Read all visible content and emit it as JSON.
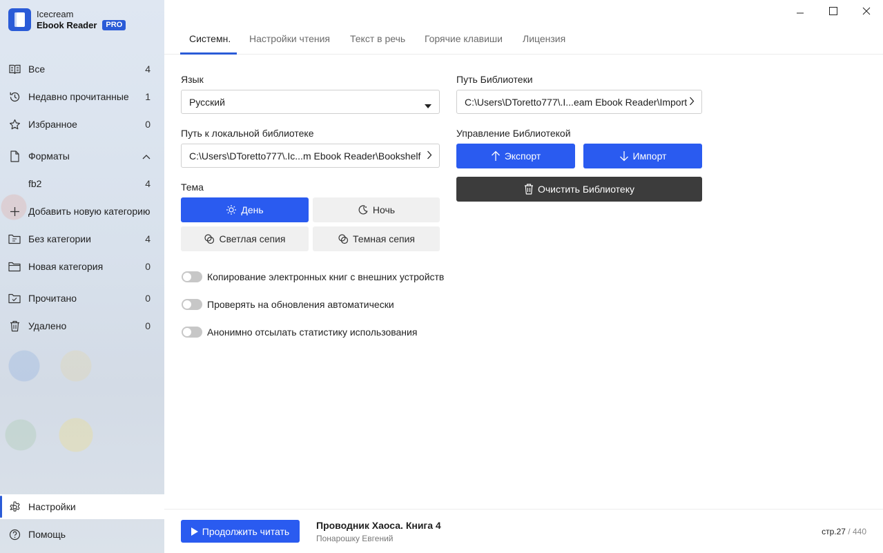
{
  "app": {
    "name_line1": "Icecream",
    "name_line2": "Ebook Reader",
    "badge": "PRO"
  },
  "sidebar": {
    "items": [
      {
        "label": "Все",
        "count": "4",
        "icon": "book-open-icon"
      },
      {
        "label": "Недавно прочитанные",
        "count": "1",
        "icon": "history-icon"
      },
      {
        "label": "Избранное",
        "count": "0",
        "icon": "star-icon"
      },
      {
        "label": "Форматы",
        "icon": "file-icon"
      },
      {
        "label": "fb2",
        "count": "4"
      },
      {
        "label": "Добавить новую категорию",
        "icon": "plus-icon"
      },
      {
        "label": "Без категории",
        "count": "4",
        "icon": "folder-books-icon"
      },
      {
        "label": "Новая категория",
        "count": "0",
        "icon": "folder-icon"
      },
      {
        "label": "Прочитано",
        "count": "0",
        "icon": "folder-check-icon"
      },
      {
        "label": "Удалено",
        "count": "0",
        "icon": "trash-icon"
      }
    ],
    "settings_label": "Настройки",
    "help_label": "Помощь"
  },
  "tabs": [
    "Системн.",
    "Настройки чтения",
    "Текст в речь",
    "Горячие клавиши",
    "Лицензия"
  ],
  "settings": {
    "language_label": "Язык",
    "language_value": "Русский",
    "local_path_label": "Путь к локальной библиотеке",
    "local_path_value": "C:\\Users\\DToretto777\\.Ic...m Ebook Reader\\Bookshelf",
    "theme_label": "Тема",
    "themes": [
      "День",
      "Ночь",
      "Светлая сепия",
      "Темная сепия"
    ],
    "selected_theme": "День",
    "library_path_label": "Путь Библиотеки",
    "library_path_value": "C:\\Users\\DToretto777\\.I...eam Ebook Reader\\Import",
    "library_manage_label": "Управление Библиотекой",
    "export_label": "Экспорт",
    "import_label": "Импорт",
    "clear_label": "Очистить Библиотеку",
    "toggles": [
      {
        "label": "Копирование электронных книг с внешних устройств",
        "on": false
      },
      {
        "label": "Проверять на обновления автоматически",
        "on": false
      },
      {
        "label": "Анонимно отсылать статистику использования",
        "on": false
      }
    ]
  },
  "footer": {
    "continue_label": "Продолжить читать",
    "book_title": "Проводник Хаоса. Книга 4",
    "book_author": "Понарошку Евгений",
    "page_current": "стр.27",
    "page_total": " / 440"
  },
  "colors": {
    "accent": "#2a5bf0",
    "dark_button": "#3c3c3c"
  }
}
